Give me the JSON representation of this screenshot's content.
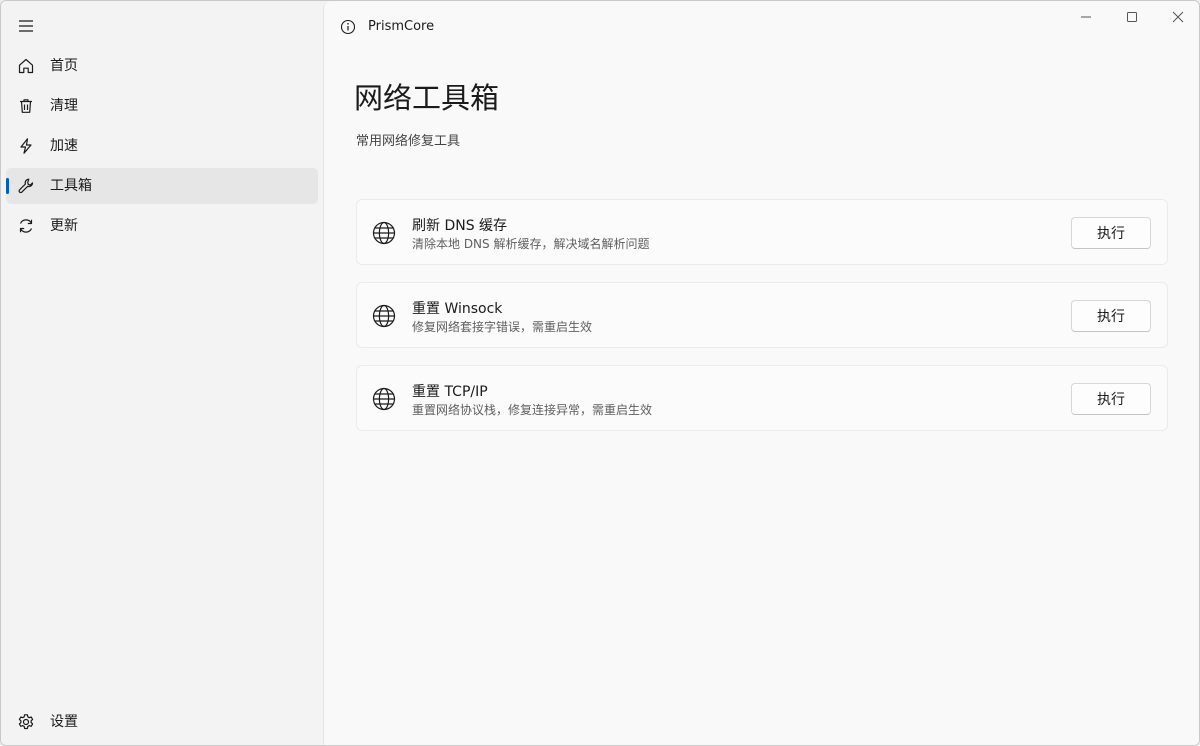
{
  "app": {
    "title": "PrismCore"
  },
  "sidebar": {
    "menu_icon": "hamburger-icon",
    "items": [
      {
        "label": "首页",
        "icon": "home-icon",
        "selected": false
      },
      {
        "label": "清理",
        "icon": "trash-icon",
        "selected": false
      },
      {
        "label": "加速",
        "icon": "lightning-icon",
        "selected": false
      },
      {
        "label": "工具箱",
        "icon": "wrench-icon",
        "selected": true
      },
      {
        "label": "更新",
        "icon": "refresh-icon",
        "selected": false
      }
    ],
    "footer_item": {
      "label": "设置",
      "icon": "gear-icon"
    }
  },
  "page": {
    "title": "网络工具箱",
    "subtitle": "常用网络修复工具"
  },
  "tools": [
    {
      "title": "刷新 DNS 缓存",
      "description": "清除本地 DNS 解析缓存，解决域名解析问题",
      "button": "执行",
      "icon": "globe-icon"
    },
    {
      "title": "重置 Winsock",
      "description": "修复网络套接字错误，需重启生效",
      "button": "执行",
      "icon": "globe-icon"
    },
    {
      "title": "重置 TCP/IP",
      "description": "重置网络协议栈，修复连接异常，需重启生效",
      "button": "执行",
      "icon": "globe-icon"
    }
  ],
  "colors": {
    "accent": "#005fb8",
    "sidebar_bg": "#f3f3f3",
    "content_bg": "#f9f9f9",
    "card_bg": "#fbfbfb"
  }
}
